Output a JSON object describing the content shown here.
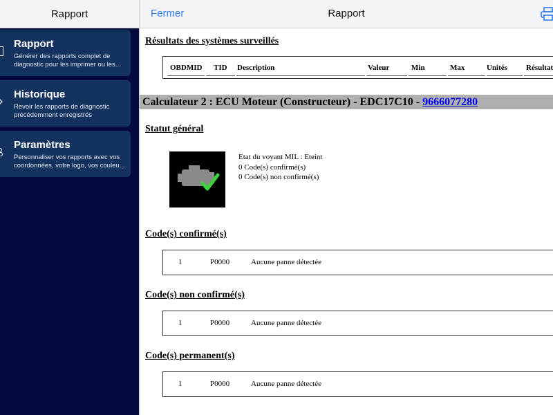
{
  "sidebar": {
    "title": "Rapport",
    "items": [
      {
        "title": "Rapport",
        "desc": "Générer des rapports complet de diagnostic pour les imprimer ou les..."
      },
      {
        "title": "Historique",
        "desc": "Revoir les rapports de diagnostic précédemment enregistrés"
      },
      {
        "title": "Paramètres",
        "desc": "Personnaliser vos rapports avec vos coordonnées, votre logo, vos couleu..."
      }
    ]
  },
  "topbar": {
    "close_label": "Fermer",
    "title": "Rapport"
  },
  "report": {
    "monitored_heading": "Résultats des systèmes surveillés",
    "columns": [
      "OBDMID",
      "TID",
      "Description",
      "Valeur",
      "Min",
      "Max",
      "Unités",
      "Résultat"
    ],
    "calculator_prefix": "Calculateur 2 : ECU Moteur (Constructeur) - EDC17C10 - ",
    "calculator_link": "9666077280",
    "status_heading": "Statut général",
    "mil_status": "Etat du voyant MIL : Eteint",
    "confirmed_count": "0 Code(s) confirmé(s)",
    "unconfirmed_count": "0 Code(s) non confirmé(s)",
    "confirmed_heading": "Code(s) confirmé(s)",
    "unconfirmed_heading": "Code(s) non confirmé(s)",
    "permanent_heading": "Code(s) permanent(s)",
    "confirmed_row": {
      "index": "1",
      "code": "P0000",
      "text": "Aucune panne détectée"
    },
    "unconfirmed_row": {
      "index": "1",
      "code": "P0000",
      "text": "Aucune panne détectée"
    },
    "permanent_row": {
      "index": "1",
      "code": "P0000",
      "text": "Aucune panne détectée"
    }
  },
  "colors": {
    "sidebar_bg": "#050a3e",
    "card_bg": "#14325e",
    "accent": "#2d7cf0",
    "link": "#0000ee"
  }
}
